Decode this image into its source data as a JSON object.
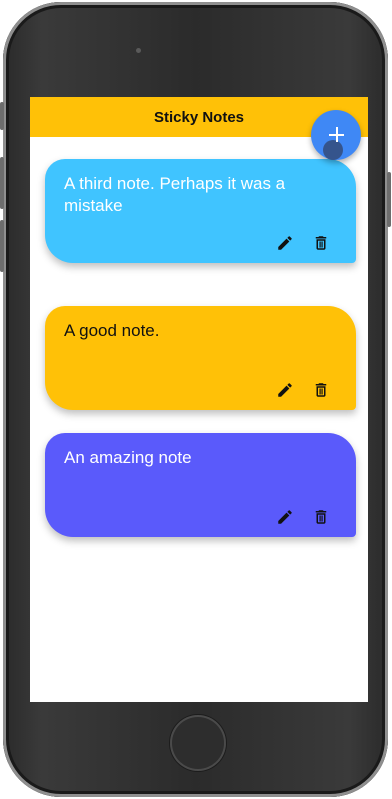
{
  "app": {
    "title": "Sticky Notes"
  },
  "fab": {
    "icon": "plus-icon",
    "color": "#3f88f5"
  },
  "notes": [
    {
      "text": "A third note. Perhaps it was a mistake",
      "color": "#40c4ff",
      "text_color": "#ffffff"
    },
    {
      "text": "A good note.",
      "color": "#ffc107",
      "text_color": "#111111"
    },
    {
      "text": "An amazing note",
      "color": "#5a5afb",
      "text_color": "#ffffff"
    }
  ],
  "note_actions": {
    "edit_icon": "pencil-icon",
    "delete_icon": "trash-icon"
  },
  "theme": {
    "appbar_color": "#ffc107",
    "background": "#ffffff"
  }
}
